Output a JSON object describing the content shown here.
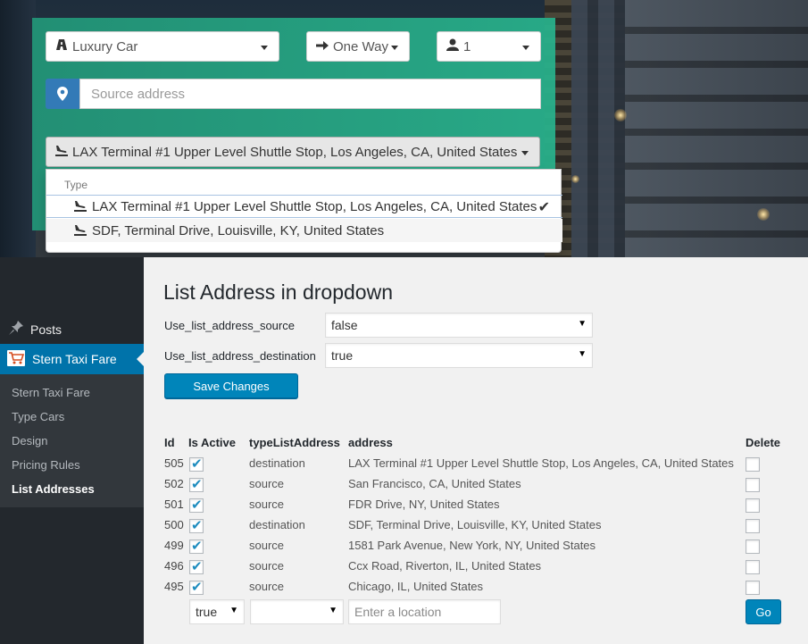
{
  "booking_form": {
    "car_type": {
      "value": "Luxury Car",
      "icon": "road-icon"
    },
    "trip_type": {
      "value": "One Way",
      "icon": "arrow-right-icon"
    },
    "passengers": {
      "value": "1",
      "icon": "user-icon"
    },
    "source": {
      "placeholder": "Source address",
      "icon": "map-marker-icon"
    },
    "destination": {
      "value": "LAX Terminal #1 Upper Level Shuttle Stop, Los Angeles, CA, United States",
      "icon": "plane-landing-icon",
      "menu": {
        "header": "Type",
        "options": [
          {
            "label": "LAX Terminal #1 Upper Level Shuttle Stop, Los Angeles, CA, United States",
            "selected": true
          },
          {
            "label": "SDF, Terminal Drive, Louisville, KY, United States",
            "selected": false
          }
        ]
      }
    }
  },
  "admin_menu": {
    "posts": "Posts",
    "plugin": "Stern Taxi Fare",
    "submenu": [
      "Stern Taxi Fare",
      "Type Cars",
      "Design",
      "Pricing Rules",
      "List Addresses"
    ],
    "current": "List Addresses"
  },
  "settings": {
    "title": "List Address in dropdown",
    "source_label": "Use_list_address_source",
    "source_value": "false",
    "destination_label": "Use_list_address_destination",
    "destination_value": "true",
    "save_label": "Save Changes"
  },
  "table": {
    "headers": {
      "id": "Id",
      "is_active": "Is Active",
      "type": "typeListAddress",
      "address": "address",
      "delete": "Delete"
    },
    "rows": [
      {
        "id": "505",
        "active": true,
        "type": "destination",
        "address": "LAX Terminal #1 Upper Level Shuttle Stop, Los Angeles, CA, United States"
      },
      {
        "id": "502",
        "active": true,
        "type": "source",
        "address": "San Francisco, CA, United States"
      },
      {
        "id": "501",
        "active": true,
        "type": "source",
        "address": "FDR Drive, NY, United States"
      },
      {
        "id": "500",
        "active": true,
        "type": "destination",
        "address": "SDF, Terminal Drive, Louisville, KY, United States"
      },
      {
        "id": "499",
        "active": true,
        "type": "source",
        "address": "1581 Park Avenue, New York, NY, United States"
      },
      {
        "id": "496",
        "active": true,
        "type": "source",
        "address": "Ccx Road, Riverton, IL, United States"
      },
      {
        "id": "495",
        "active": true,
        "type": "source",
        "address": "Chicago, IL, United States"
      }
    ],
    "new_row": {
      "active_value": "true",
      "type_value": "",
      "location_placeholder": "Enter a location",
      "go_label": "Go"
    }
  },
  "colors": {
    "panel_teal": "#27a585",
    "wp_blue": "#0073aa",
    "button_blue": "#0085ba",
    "admin_dark": "#23282d"
  }
}
